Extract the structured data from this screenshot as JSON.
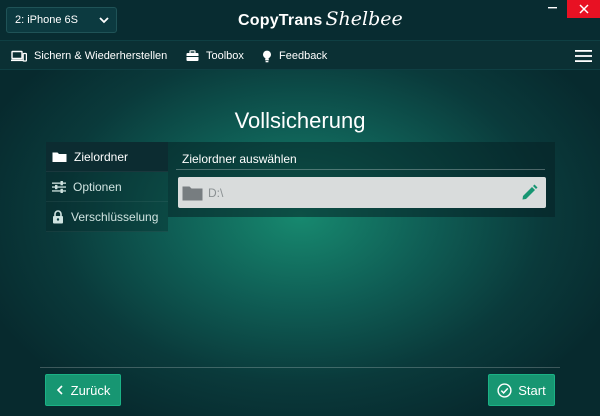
{
  "titlebar": {
    "device": "2: iPhone 6S",
    "brand_main": "CopyTrans",
    "brand_script": "Shelbee"
  },
  "menu": {
    "backup_restore": "Sichern & Wiederherstellen",
    "toolbox": "Toolbox",
    "feedback": "Feedback"
  },
  "page": {
    "title": "Vollsicherung"
  },
  "sidebar": {
    "items": [
      {
        "label": "Zielordner",
        "icon": "folder-icon",
        "active": true
      },
      {
        "label": "Optionen",
        "icon": "sliders-icon",
        "active": false
      },
      {
        "label": "Verschlüsselung",
        "icon": "lock-icon",
        "active": false
      }
    ]
  },
  "panel": {
    "header": "Zielordner auswählen",
    "path": "D:\\"
  },
  "footer": {
    "back_label": "Zurück",
    "start_label": "Start"
  },
  "colors": {
    "accent": "#179672",
    "close": "#e81123",
    "titlebar": "#082c31"
  }
}
